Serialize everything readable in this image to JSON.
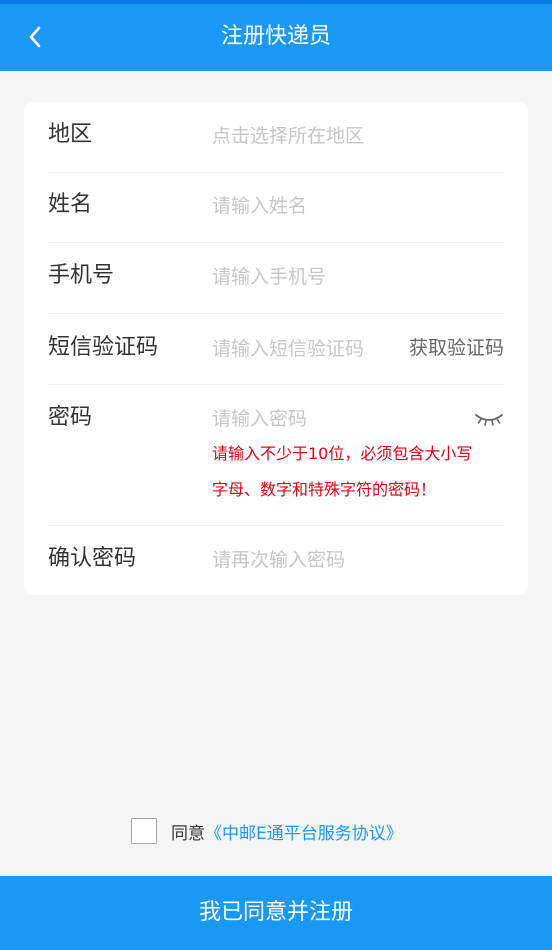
{
  "colors": {
    "primary": "#1a98f6",
    "background": "#f5f5f5",
    "warning": "#e60012",
    "placeholder": "#c6c6c6",
    "label": "#333333"
  },
  "header": {
    "title": "注册快递员",
    "back_icon": "chevron-left-icon"
  },
  "form": {
    "region": {
      "label": "地区",
      "placeholder": "点击选择所在地区"
    },
    "name": {
      "label": "姓名",
      "placeholder": "请输入姓名"
    },
    "phone": {
      "label": "手机号",
      "placeholder": "请输入手机号"
    },
    "sms_code": {
      "label": "短信验证码",
      "placeholder": "请输入短信验证码",
      "action": "获取验证码"
    },
    "password": {
      "label": "密码",
      "placeholder": "请输入密码",
      "toggle_icon": "eye-closed-icon",
      "hint_line1": "请输入不少于10位，必须包含大小写",
      "hint_line2": "字母、数字和特殊字符的密码！"
    },
    "confirm_password": {
      "label": "确认密码",
      "placeholder": "请再次输入密码"
    }
  },
  "agreement": {
    "prefix": "同意",
    "link": "《中邮E通平台服务协议》"
  },
  "submit_label": "我已同意并注册"
}
